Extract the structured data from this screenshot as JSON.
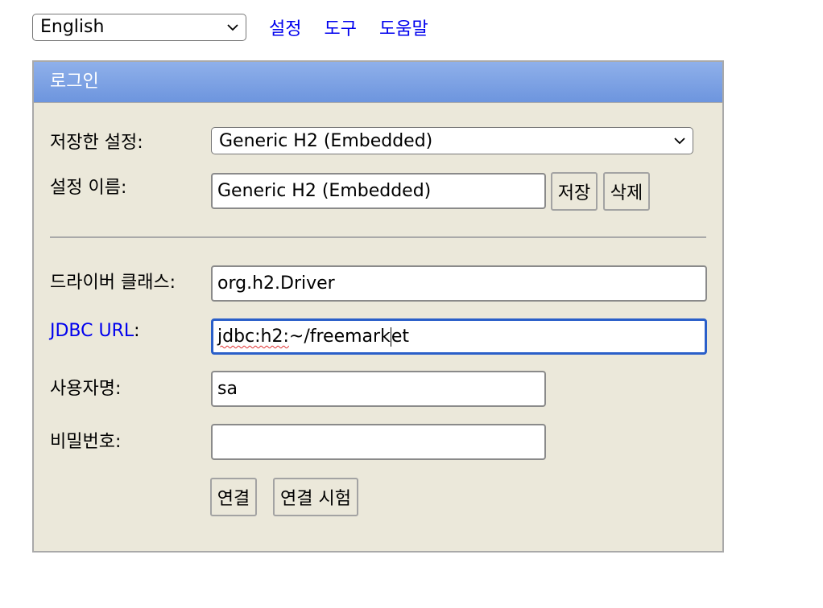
{
  "topbar": {
    "language_selected": "English",
    "links": [
      "설정",
      "도구",
      "도움말"
    ]
  },
  "panel": {
    "title": "로그인",
    "saved_settings_label": "저장한 설정:",
    "saved_settings_value": "Generic H2 (Embedded)",
    "setting_name_label": "설정 이름:",
    "setting_name_value": "Generic H2 (Embedded)",
    "save_button": "저장",
    "delete_button": "삭제",
    "driver_class_label": "드라이버 클래스:",
    "driver_class_value": "org.h2.Driver",
    "jdbc_url_label": "JDBC URL",
    "jdbc_url_colon": ":",
    "jdbc_url_value_a": "jdbc:h2:",
    "jdbc_url_value_b": "~/freemark",
    "jdbc_url_value_c": "et",
    "username_label": "사용자명:",
    "username_value": "sa",
    "password_label": "비밀번호:",
    "password_value": "",
    "connect_button": "연결",
    "test_connection_button": "연결 시험"
  },
  "colors": {
    "link": "#0000ee",
    "panel_bg": "#ebe8da",
    "title_bar": "#7da3e4",
    "focus_border": "#2a5fc9"
  }
}
